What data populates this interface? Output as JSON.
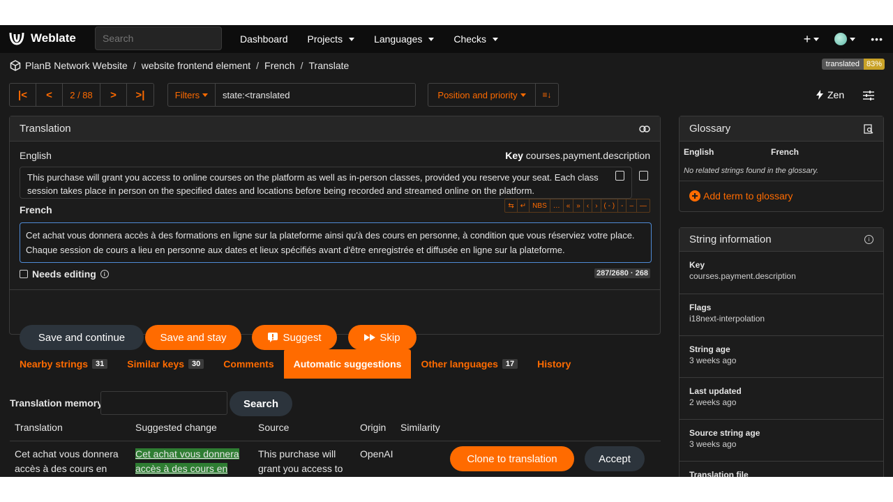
{
  "navbar": {
    "brand": "Weblate",
    "search_placeholder": "Search",
    "links": [
      "Dashboard",
      "Projects",
      "Languages",
      "Checks"
    ],
    "plus": "+",
    "more": "•••"
  },
  "breadcrumb": {
    "items": [
      "PlanB Network Website",
      "website frontend element",
      "French",
      "Translate"
    ],
    "separator": "/",
    "badge_label": "translated",
    "badge_value": "83%"
  },
  "pager": {
    "first": "|<",
    "prev": "<",
    "position": "2 / 88",
    "next": ">",
    "last": ">|"
  },
  "filters": {
    "label": "Filters",
    "query": "state:<translated"
  },
  "sort": {
    "label": "Position and priority",
    "direction": "≡↓"
  },
  "zen": {
    "label": "Zen"
  },
  "translation": {
    "title": "Translation",
    "source_language": "English",
    "key_label": "Key",
    "key_value": "courses.payment.description",
    "source_text": "This purchase will grant you access to online courses on the platform as well as in-person classes, provided you reserve your seat. Each class session takes place in person on the specified dates and locations before being recorded and streamed online on the platform.",
    "target_language": "French",
    "special_chars": [
      "⇆",
      "↵",
      "NBS",
      "…",
      "«",
      "»",
      "‹",
      "›",
      "( - )",
      "-",
      "–",
      "—"
    ],
    "target_text": "Cet achat vous donnera accès à des formations en ligne sur la plateforme ainsi qu'à des cours en personne, à condition que vous réserviez votre place. Chaque session de cours a lieu en personne aux dates et lieux spécifiés avant d'être enregistrée et diffusée en ligne sur la plateforme.",
    "needs_editing": "Needs editing",
    "counter": "287/2680 · 268",
    "buttons": {
      "save_continue": "Save and continue",
      "save_stay": "Save and stay",
      "suggest": "Suggest",
      "skip": "Skip"
    }
  },
  "tabs": [
    {
      "label": "Nearby strings",
      "count": "31"
    },
    {
      "label": "Similar keys",
      "count": "30"
    },
    {
      "label": "Comments",
      "count": ""
    },
    {
      "label": "Automatic suggestions",
      "count": ""
    },
    {
      "label": "Other languages",
      "count": "17"
    },
    {
      "label": "History",
      "count": ""
    }
  ],
  "memory": {
    "label": "Translation memory",
    "search_button": "Search",
    "columns": [
      "Translation",
      "Suggested change",
      "Source",
      "Origin",
      "Similarity"
    ],
    "row": {
      "translation": "Cet achat vous donnera accès à des cours en ligne",
      "suggested": "Cet achat vous donnera accès à des cours en ligne",
      "source": "This purchase will grant you access to",
      "origin": "OpenAI",
      "clone_button": "Clone to translation",
      "accept_button": "Accept"
    }
  },
  "glossary": {
    "title": "Glossary",
    "col_source": "English",
    "col_target": "French",
    "empty_text": "No related strings found in the glossary.",
    "add_term": "Add term to glossary"
  },
  "string_info": {
    "title": "String information",
    "rows": [
      {
        "label": "Key",
        "value": "courses.payment.description"
      },
      {
        "label": "Flags",
        "value": "i18next-interpolation"
      },
      {
        "label": "String age",
        "value": "3 weeks ago"
      },
      {
        "label": "Last updated",
        "value": "2 weeks ago"
      },
      {
        "label": "Source string age",
        "value": "3 weeks ago"
      },
      {
        "label": "Translation file",
        "value": ""
      }
    ]
  },
  "colors": {
    "accent": "#ff6b00",
    "background": "#1a1a1a",
    "dark_button": "#2c343c",
    "badge_progress": "#c9a227",
    "suggestion_highlight": "#2e7d32"
  }
}
